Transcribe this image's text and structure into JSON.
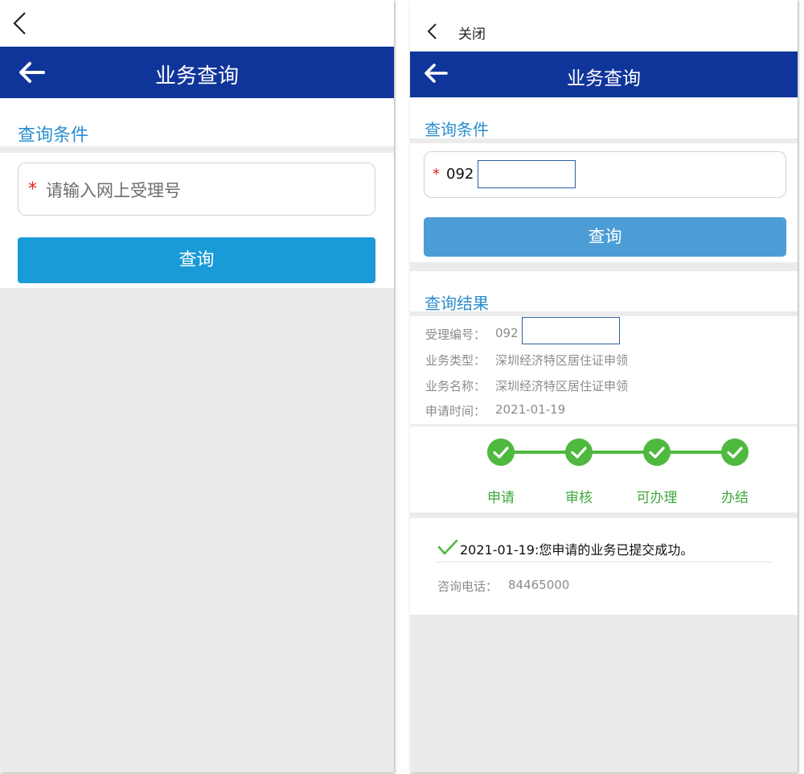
{
  "left": {
    "nav_title": "业务查询",
    "section_title": "查询条件",
    "input": {
      "required_mark": "*",
      "placeholder": "请输入网上受理号"
    },
    "query_button": "查询"
  },
  "right": {
    "close_label": "关闭",
    "nav_title": "业务查询",
    "section_title": "查询条件",
    "input": {
      "required_mark": "*",
      "value": "092"
    },
    "query_button": "查询",
    "results_title": "查询结果",
    "fields": [
      {
        "label": "受理编号：",
        "value": "092"
      },
      {
        "label": "业务类型：",
        "value": "深圳经济特区居住证申领"
      },
      {
        "label": "业务名称：",
        "value": "深圳经济特区居住证申领"
      },
      {
        "label": "申请时间：",
        "value": "2021-01-19"
      }
    ],
    "steps": [
      "申请",
      "审核",
      "可办理",
      "办结"
    ],
    "status_message": "2021-01-19:您申请的业务已提交成功。",
    "hotline": {
      "label": "咨询电话：",
      "value": "84465000"
    }
  },
  "colors": {
    "nav_bar": "#10359a",
    "accent_blue": "#2b8ed0",
    "button_left": "#1a9ad6",
    "button_right": "#4c9cd6",
    "step_green": "#4fb83f",
    "required_red": "#e02020"
  },
  "icons": [
    "back-chevron-icon",
    "back-arrow-icon",
    "check-icon"
  ]
}
